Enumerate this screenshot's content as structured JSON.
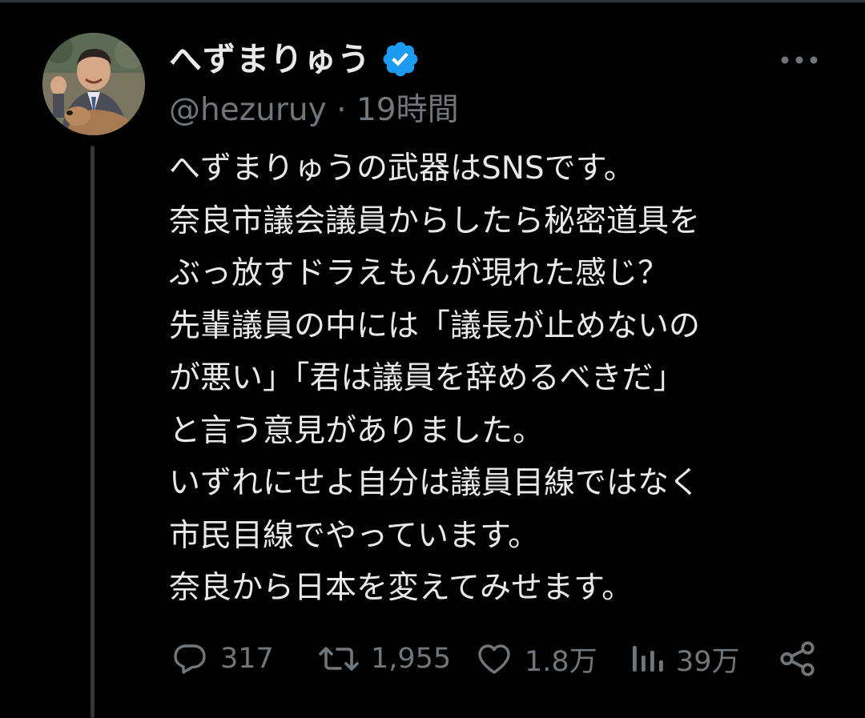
{
  "tweet": {
    "author": {
      "display_name": "へずまりゅう",
      "handle": "@hezuruy",
      "verified": true,
      "avatar_icon": "profile-photo"
    },
    "separator": "·",
    "timestamp": "19時間",
    "body_lines": [
      "へずまりゅうの武器はSNSです。",
      "奈良市議会議員からしたら秘密道具を",
      "ぶっ放すドラえもんが現れた感じ？",
      "先輩議員の中には「議長が止めないの",
      "が悪い」「君は議員を辞めるべきだ」",
      "と言う意見がありました。",
      "いずれにせよ自分は議員目線ではなく",
      "市民目線でやっています。",
      "奈良から日本を変えてみせます。"
    ],
    "stats": {
      "replies": "317",
      "reposts": "1,955",
      "likes": "1.8万",
      "views": "39万"
    }
  },
  "icons": {
    "more": "more-icon",
    "reply": "reply-icon",
    "repost": "repost-icon",
    "like": "like-icon",
    "views": "views-icon",
    "share": "share-icon",
    "verified": "verified-icon"
  },
  "colors": {
    "background": "#000000",
    "text_primary": "#e7e9ea",
    "text_secondary": "#71767b",
    "verified_blue": "#1d9bf0",
    "thread_line": "#333639"
  }
}
